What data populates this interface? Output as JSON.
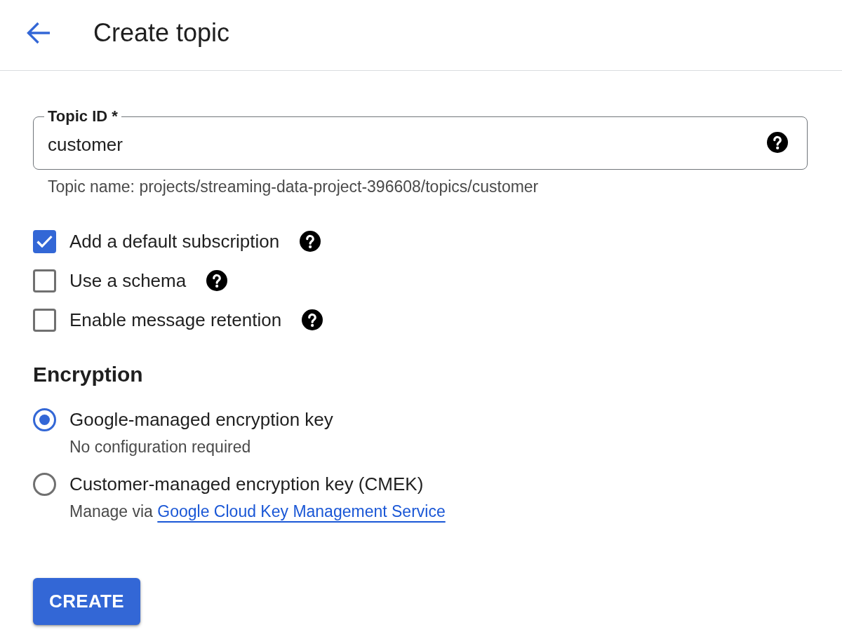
{
  "header": {
    "title": "Create topic"
  },
  "topic_id": {
    "label": "Topic ID *",
    "value": "customer",
    "hint": "Topic name: projects/streaming-data-project-396608/topics/customer"
  },
  "options": [
    {
      "label": "Add a default subscription",
      "checked": true
    },
    {
      "label": "Use a schema",
      "checked": false
    },
    {
      "label": "Enable message retention",
      "checked": false
    }
  ],
  "encryption": {
    "heading": "Encryption",
    "choices": [
      {
        "label": "Google-managed encryption key",
        "description": "No configuration required",
        "selected": true
      },
      {
        "label": "Customer-managed encryption key (CMEK)",
        "description": "Manage via",
        "link": "Google Cloud Key Management Service",
        "selected": false
      }
    ]
  },
  "create_button": {
    "label": "CREATE"
  }
}
